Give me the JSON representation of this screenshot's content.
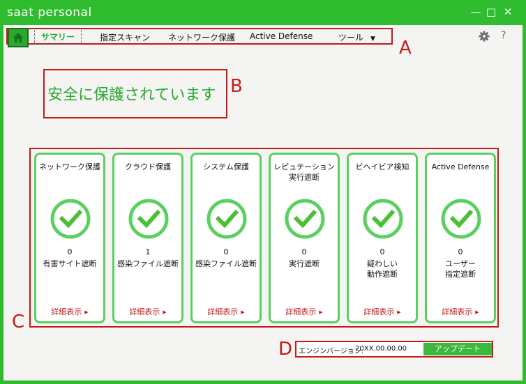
{
  "window": {
    "title": "saat personal"
  },
  "nav": {
    "tabs": [
      "サマリー",
      "指定スキャン",
      "ネットワーク保護",
      "Active Defense",
      "ツール"
    ],
    "help": "?"
  },
  "labels": {
    "a": "A",
    "b": "B",
    "c": "C",
    "d": "D"
  },
  "status": {
    "text": "安全に保護されています"
  },
  "cards": [
    {
      "title": "ネットワーク保護",
      "count": "0",
      "desc": "有害サイト遮断",
      "detail": "詳細表示"
    },
    {
      "title": "クラウド保護",
      "count": "1",
      "desc": "感染ファイル遮断",
      "detail": "詳細表示"
    },
    {
      "title": "システム保護",
      "count": "0",
      "desc": "感染ファイル遮断",
      "detail": "詳細表示"
    },
    {
      "title": "レピュテーション\n実行遮断",
      "count": "0",
      "desc": "実行遮断",
      "detail": "詳細表示"
    },
    {
      "title": "ビヘイビア検知",
      "count": "0",
      "desc": "疑わしい\n動作遮断",
      "detail": "詳細表示"
    },
    {
      "title": "Active Defense",
      "count": "0",
      "desc": "ユーザー\n指定遮断",
      "detail": "詳細表示"
    }
  ],
  "engine": {
    "label": "エンジンバージョン:",
    "version": "20XX.00.00.00",
    "update_label": "アップデート"
  },
  "colors": {
    "brand_green": "#2fbd2f",
    "accent_green": "#2aa830",
    "annotation_red": "#c41b1b"
  }
}
